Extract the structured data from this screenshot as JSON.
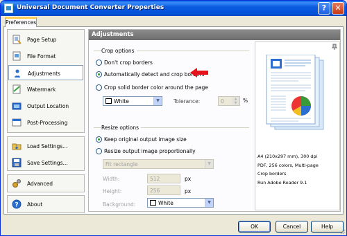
{
  "window": {
    "title": "Universal Document Converter Properties",
    "help_glyph": "?",
    "close_glyph": "✕"
  },
  "tabs": [
    "Preferences"
  ],
  "sidebar": {
    "groups": [
      {
        "items": [
          {
            "label": "Page Setup",
            "icon": "page-setup-icon"
          },
          {
            "label": "File Format",
            "icon": "file-format-icon"
          },
          {
            "label": "Adjustments",
            "icon": "adjustments-icon",
            "active": true
          },
          {
            "label": "Watermark",
            "icon": "watermark-icon"
          },
          {
            "label": "Output Location",
            "icon": "output-location-icon"
          },
          {
            "label": "Post-Processing",
            "icon": "post-processing-icon"
          }
        ]
      },
      {
        "items": [
          {
            "label": "Load Settings...",
            "icon": "load-settings-icon"
          },
          {
            "label": "Save Settings...",
            "icon": "save-settings-icon"
          }
        ]
      },
      {
        "items": [
          {
            "label": "Advanced",
            "icon": "advanced-icon"
          }
        ]
      },
      {
        "items": [
          {
            "label": "About",
            "icon": "about-icon"
          }
        ]
      }
    ]
  },
  "content": {
    "header": "Adjustments",
    "crop": {
      "group_label": "Crop options",
      "options": [
        {
          "label": "Don't crop borders",
          "selected": false
        },
        {
          "label": "Automatically detect and crop borders",
          "selected": true
        },
        {
          "label": "Crop solid border color around the page",
          "selected": false
        }
      ],
      "color_value": "White",
      "tolerance_label": "Tolerance:",
      "tolerance_value": "0",
      "tolerance_unit": "%"
    },
    "resize": {
      "group_label": "Resize options",
      "options": [
        {
          "label": "Keep original output image size",
          "selected": true
        },
        {
          "label": "Resize output image proportionally",
          "selected": false
        }
      ],
      "fit_value": "Fit rectangle",
      "width_label": "Width:",
      "width_value": "512",
      "width_unit": "px",
      "height_label": "Height:",
      "height_value": "256",
      "height_unit": "px",
      "background_label": "Background:",
      "background_value": "White"
    }
  },
  "preview": {
    "lines": [
      "A4 (210x297 mm), 300 dpi",
      "PDF, 256 colors, Multi-page",
      "Crop borders",
      "Run Adobe Reader 9.1"
    ]
  },
  "buttons": {
    "ok": "OK",
    "cancel": "Cancel",
    "help": "Help"
  },
  "colors": {
    "accent_arrow": "#e5141c",
    "title_bar": "#0452d8",
    "selected_radio": "#21a121"
  }
}
